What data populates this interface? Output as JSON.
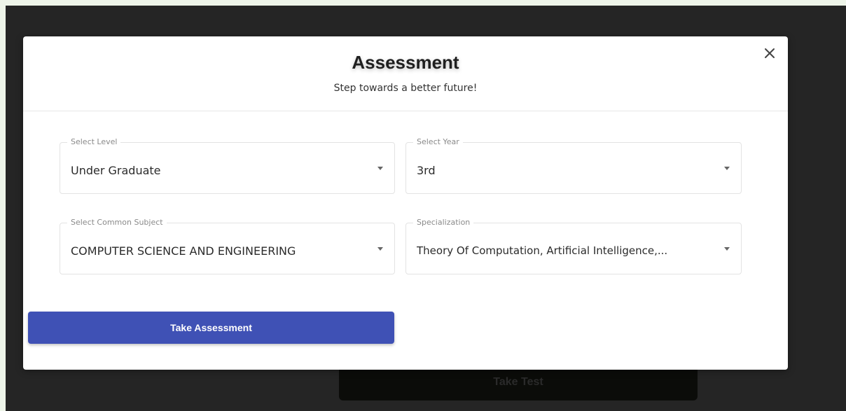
{
  "background": {
    "take_test_label": "Take Test"
  },
  "modal": {
    "title": "Assessment",
    "subtitle": "Step towards a better future!",
    "close_icon": "close-icon",
    "fields": {
      "level": {
        "label": "Select Level",
        "value": "Under Graduate"
      },
      "year": {
        "label": "Select Year",
        "value": "3rd"
      },
      "subject": {
        "label": "Select Common Subject",
        "value": "COMPUTER SCIENCE AND ENGINEERING"
      },
      "specialization": {
        "label": "Specialization",
        "value": "Theory Of Computation, Artificial Intelligence,..."
      }
    },
    "submit_label": "Take Assessment"
  },
  "colors": {
    "primary": "#3f51b5",
    "overlay": "#252525",
    "page_background": "#eef5e9"
  }
}
